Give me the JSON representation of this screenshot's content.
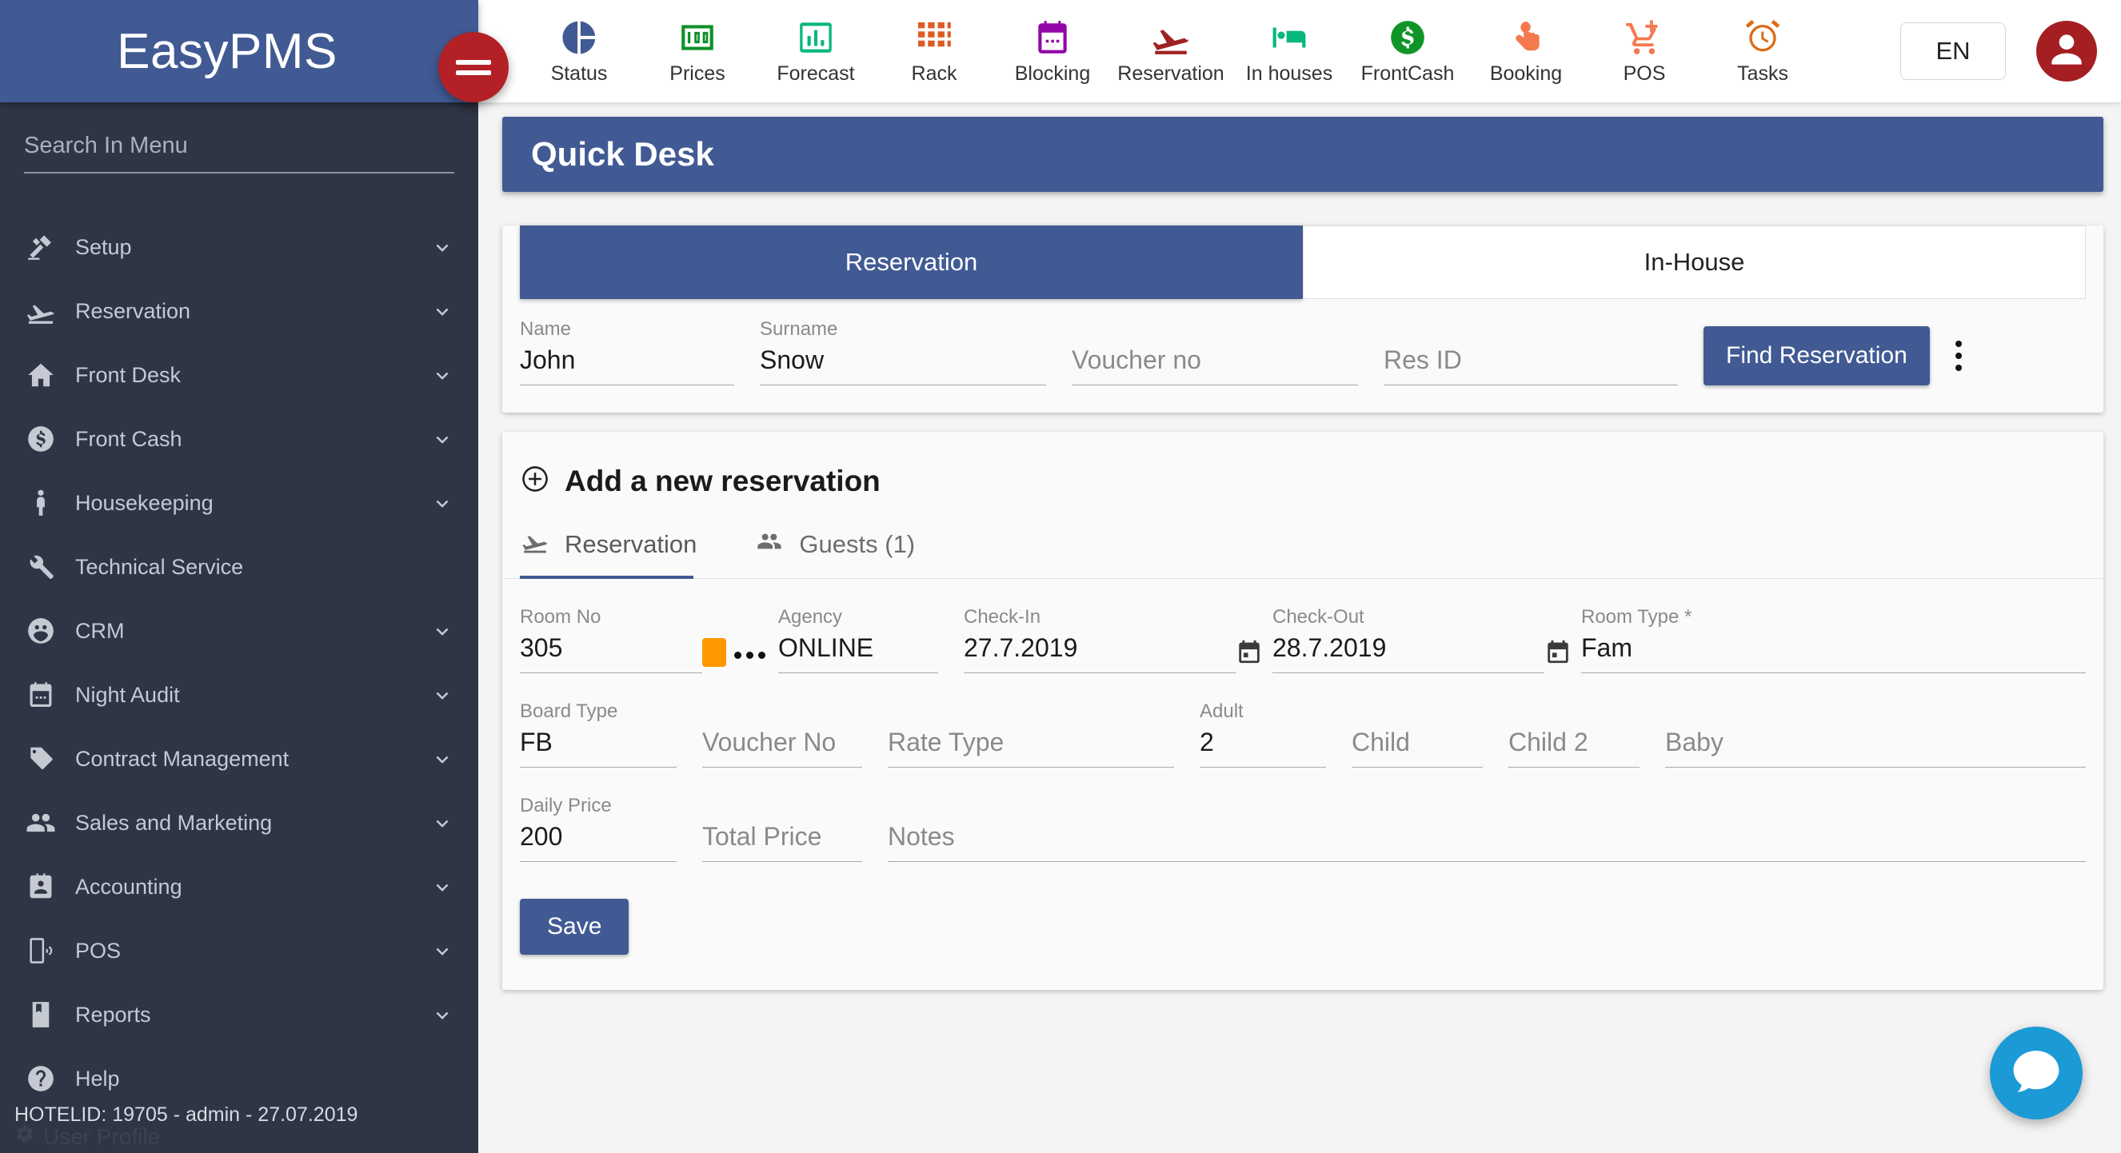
{
  "brand": {
    "title": "EasyPMS",
    "menu_toggle_icon": "hamburger-icon"
  },
  "sidebar": {
    "search_placeholder": "Search In Menu",
    "items": [
      {
        "label": "Setup",
        "icon": "tools-icon",
        "chevron": true
      },
      {
        "label": "Reservation",
        "icon": "plane-landing-icon",
        "chevron": true
      },
      {
        "label": "Front Desk",
        "icon": "home-icon",
        "chevron": true
      },
      {
        "label": "Front Cash",
        "icon": "dollar-circle-icon",
        "chevron": true
      },
      {
        "label": "Housekeeping",
        "icon": "person-icon",
        "chevron": true
      },
      {
        "label": "Technical Service",
        "icon": "wrench-icon",
        "chevron": false
      },
      {
        "label": "CRM",
        "icon": "people-circle-icon",
        "chevron": true
      },
      {
        "label": "Night Audit",
        "icon": "calendar-icon",
        "chevron": true
      },
      {
        "label": "Contract Management",
        "icon": "tag-icon",
        "chevron": true
      },
      {
        "label": "Sales and Marketing",
        "icon": "people-icon",
        "chevron": true
      },
      {
        "label": "Accounting",
        "icon": "contact-card-icon",
        "chevron": true
      },
      {
        "label": "POS",
        "icon": "mobile-pos-icon",
        "chevron": true
      },
      {
        "label": "Reports",
        "icon": "book-icon",
        "chevron": true
      },
      {
        "label": "Help",
        "icon": "question-circle-icon",
        "chevron": false
      }
    ],
    "footer_status": "HOTELID: 19705 - admin - 27.07.2019",
    "footer_user_profile": "User Profile"
  },
  "topnav": {
    "items": [
      {
        "label": "Status",
        "icon": "pie-chart-icon",
        "color": "#415a94"
      },
      {
        "label": "Prices",
        "icon": "price-100-icon",
        "color": "#10912a"
      },
      {
        "label": "Forecast",
        "icon": "bar-chart-icon",
        "color": "#08b87a"
      },
      {
        "label": "Rack",
        "icon": "grid-icon",
        "color": "#dd5c26"
      },
      {
        "label": "Blocking",
        "icon": "calendar-icon",
        "color": "#9205a8"
      },
      {
        "label": "Reservation",
        "icon": "plane-landing-icon",
        "color": "#9e2222"
      },
      {
        "label": "In houses",
        "icon": "bed-icon",
        "color": "#08b87a"
      },
      {
        "label": "FrontCash",
        "icon": "dollar-circle-icon",
        "color": "#0f9527"
      },
      {
        "label": "Booking",
        "icon": "touch-hand-icon",
        "color": "#f5794f"
      },
      {
        "label": "POS",
        "icon": "cart-plus-icon",
        "color": "#f5794f"
      },
      {
        "label": "Tasks",
        "icon": "alarm-clock-icon",
        "color": "#dd6b16"
      }
    ],
    "language": "EN",
    "avatar_icon": "user-avatar-icon"
  },
  "page": {
    "title": "Quick Desk"
  },
  "search_panel": {
    "tabs": [
      {
        "label": "Reservation",
        "active": true
      },
      {
        "label": "In-House",
        "active": false
      }
    ],
    "fields": [
      {
        "label": "Name",
        "value": "John",
        "placeholder": ""
      },
      {
        "label": "Surname",
        "value": "Snow",
        "placeholder": ""
      },
      {
        "label": "",
        "value": "",
        "placeholder": "Voucher no"
      },
      {
        "label": "",
        "value": "",
        "placeholder": "Res ID"
      }
    ],
    "find_button": "Find Reservation",
    "more_icon": "kebab-menu-icon"
  },
  "add_reservation": {
    "heading": "Add a new reservation",
    "heading_icon": "plus-circle-icon",
    "tabs": [
      {
        "label": "Reservation",
        "icon": "plane-landing-icon",
        "active": true
      },
      {
        "label": "Guests (1)",
        "icon": "people-icon",
        "active": false
      }
    ],
    "row1": [
      {
        "label": "Room No",
        "value": "305",
        "placeholder": ""
      },
      {
        "label": "Agency",
        "value": "ONLINE",
        "placeholder": ""
      },
      {
        "label": "Check-In",
        "value": "27.7.2019",
        "placeholder": ""
      },
      {
        "label": "Check-Out",
        "value": "28.7.2019",
        "placeholder": ""
      },
      {
        "label": "Room Type *",
        "value": "Fam",
        "placeholder": ""
      }
    ],
    "row2": [
      {
        "label": "Board Type",
        "value": "FB",
        "placeholder": ""
      },
      {
        "label": "",
        "value": "",
        "placeholder": "Voucher No"
      },
      {
        "label": "",
        "value": "",
        "placeholder": "Rate Type"
      },
      {
        "label": "Adult",
        "value": "2",
        "placeholder": ""
      },
      {
        "label": "",
        "value": "",
        "placeholder": "Child"
      },
      {
        "label": "",
        "value": "",
        "placeholder": "Child 2"
      },
      {
        "label": "",
        "value": "",
        "placeholder": "Baby"
      }
    ],
    "row3": [
      {
        "label": "Daily Price",
        "value": "200",
        "placeholder": ""
      },
      {
        "label": "",
        "value": "",
        "placeholder": "Total Price"
      },
      {
        "label": "",
        "value": "",
        "placeholder": "Notes"
      }
    ],
    "save_button": "Save",
    "status_chip_color": "#ff9800"
  },
  "chat_widget": {
    "icon": "chat-bubble-icon",
    "color": "#1b9ad6"
  }
}
